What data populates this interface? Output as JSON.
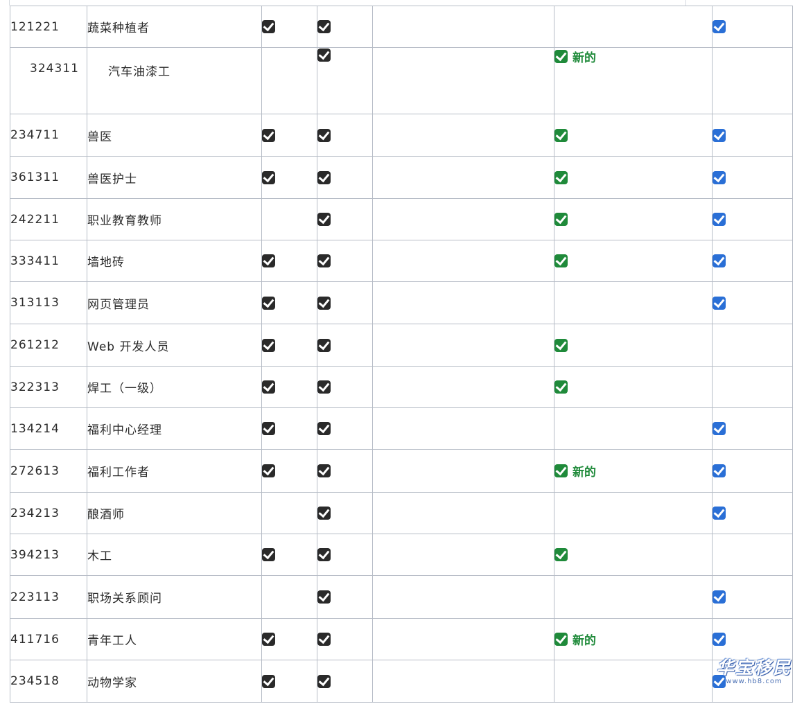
{
  "new_label": "新的",
  "rows": [
    {
      "code": "121221",
      "name": "蔬菜种植者",
      "marks": [
        "dark",
        "dark",
        "",
        "",
        "blue"
      ],
      "is_new": false
    },
    {
      "code": "324311",
      "name": "汽车油漆工",
      "marks": [
        "",
        "dark",
        "",
        "green",
        ""
      ],
      "is_new": true
    },
    {
      "code": "234711",
      "name": "兽医",
      "marks": [
        "dark",
        "dark",
        "",
        "green",
        "blue"
      ],
      "is_new": false
    },
    {
      "code": "361311",
      "name": "兽医护士",
      "marks": [
        "dark",
        "dark",
        "",
        "green",
        "blue"
      ],
      "is_new": false
    },
    {
      "code": "242211",
      "name": "职业教育教师",
      "marks": [
        "",
        "dark",
        "",
        "green",
        "blue"
      ],
      "is_new": false
    },
    {
      "code": "333411",
      "name": "墙地砖",
      "marks": [
        "dark",
        "dark",
        "",
        "green",
        "blue"
      ],
      "is_new": false
    },
    {
      "code": "313113",
      "name": "网页管理员",
      "marks": [
        "dark",
        "dark",
        "",
        "",
        "blue"
      ],
      "is_new": false
    },
    {
      "code": "261212",
      "name": "Web 开发人员",
      "marks": [
        "dark",
        "dark",
        "",
        "green",
        ""
      ],
      "is_new": false
    },
    {
      "code": "322313",
      "name": "焊工（一级）",
      "marks": [
        "dark",
        "dark",
        "",
        "green",
        ""
      ],
      "is_new": false
    },
    {
      "code": "134214",
      "name": "福利中心经理",
      "marks": [
        "dark",
        "dark",
        "",
        "",
        "blue"
      ],
      "is_new": false
    },
    {
      "code": "272613",
      "name": "福利工作者",
      "marks": [
        "dark",
        "dark",
        "",
        "green",
        "blue"
      ],
      "is_new": true
    },
    {
      "code": "234213",
      "name": "酿酒师",
      "marks": [
        "",
        "dark",
        "",
        "",
        "blue"
      ],
      "is_new": false
    },
    {
      "code": "394213",
      "name": "木工",
      "marks": [
        "dark",
        "dark",
        "",
        "green",
        ""
      ],
      "is_new": false
    },
    {
      "code": "223113",
      "name": "职场关系顾问",
      "marks": [
        "",
        "dark",
        "",
        "",
        "blue"
      ],
      "is_new": false
    },
    {
      "code": "411716",
      "name": "青年工人",
      "marks": [
        "dark",
        "dark",
        "",
        "green",
        "blue"
      ],
      "is_new": true
    },
    {
      "code": "234518",
      "name": "动物学家",
      "marks": [
        "dark",
        "dark",
        "",
        "",
        "blue"
      ],
      "is_new": false
    }
  ],
  "watermark": {
    "text": "华宝移民",
    "url": "www.hb8.com"
  }
}
